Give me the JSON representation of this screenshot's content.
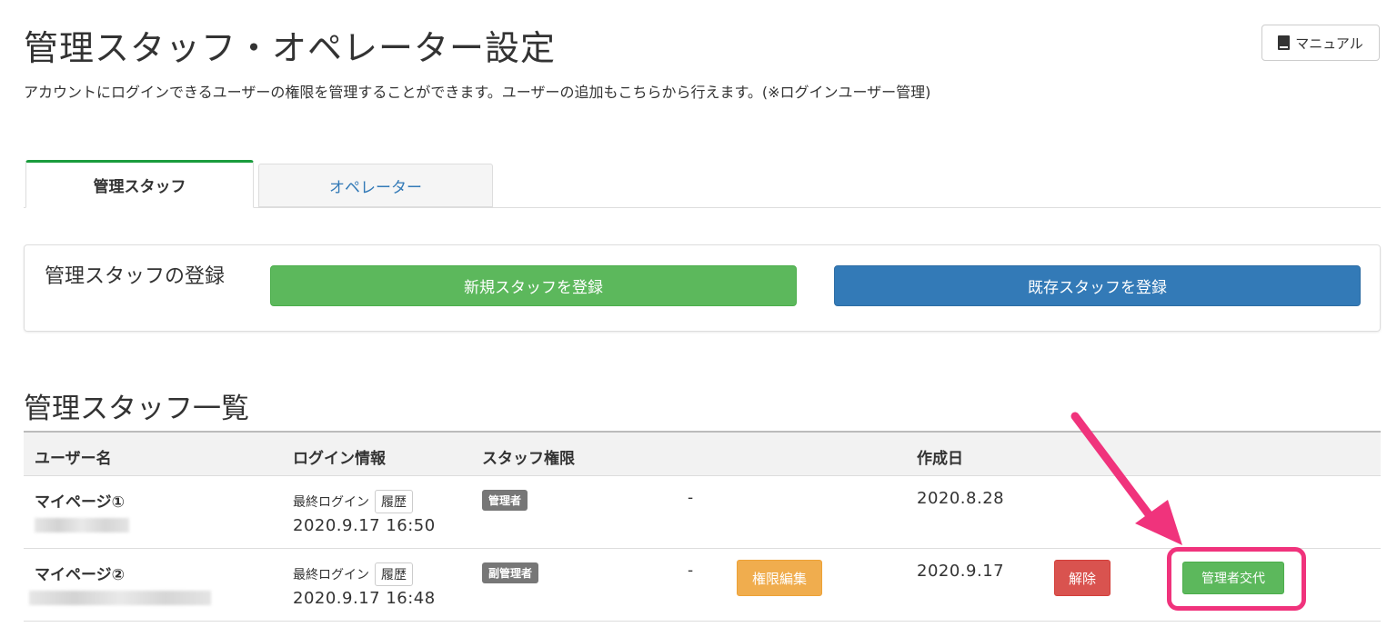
{
  "page": {
    "title": "管理スタッフ・オペレーター設定",
    "description": "アカウントにログインできるユーザーの権限を管理することができます。ユーザーの追加もこちらから行えます。(※ログインユーザー管理)",
    "manual_label": "マニュアル",
    "manual_icon": "book-icon"
  },
  "tabs": [
    {
      "label": "管理スタッフ",
      "active": true
    },
    {
      "label": "オペレーター",
      "active": false
    }
  ],
  "register": {
    "label": "管理スタッフの登録",
    "new_button": "新規スタッフを登録",
    "existing_button": "既存スタッフを登録"
  },
  "list": {
    "title": "管理スタッフ一覧",
    "columns": [
      "ユーザー名",
      "ログイン情報",
      "スタッフ権限",
      "作成日"
    ],
    "rows": [
      {
        "name": "マイページ①",
        "last_login_label": "最終ログイン",
        "history_label": "履歴",
        "login_datetime": "2020.9.17 16:50",
        "role": "管理者",
        "note": "-",
        "created": "2020.8.28"
      },
      {
        "name": "マイページ②",
        "last_login_label": "最終ログイン",
        "history_label": "履歴",
        "login_datetime": "2020.9.17 16:48",
        "role": "副管理者",
        "note": "-",
        "edit_button": "権限編集",
        "created": "2020.9.17",
        "remove_button": "解除",
        "swap_button": "管理者交代"
      }
    ]
  },
  "colors": {
    "success": "#5cb85c",
    "primary": "#337ab7",
    "warning": "#f0ad4e",
    "danger": "#d9534f",
    "highlight": "#f0337c",
    "tab_active_border": "#1a9c3d"
  }
}
